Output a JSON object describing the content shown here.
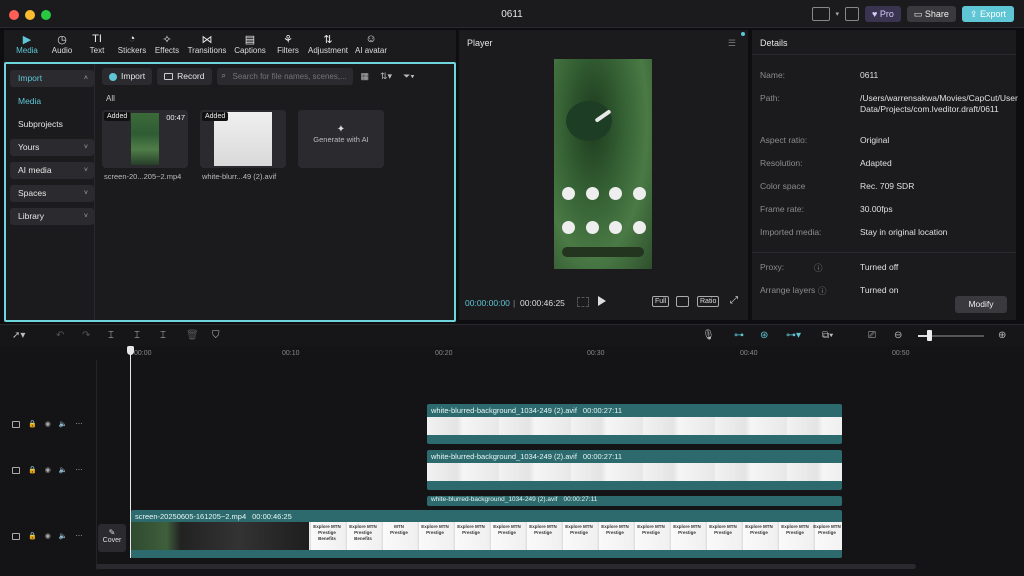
{
  "window": {
    "title": "0611"
  },
  "titlebar": {
    "pro_label": "Pro",
    "share_label": "Share",
    "export_label": "Export"
  },
  "tools": [
    {
      "label": "Media",
      "icon": "media-icon",
      "glyph": "▶"
    },
    {
      "label": "Audio",
      "icon": "audio-icon",
      "glyph": "◷"
    },
    {
      "label": "Text",
      "icon": "text-icon",
      "glyph": "TI"
    },
    {
      "label": "Stickers",
      "icon": "stickers-icon",
      "glyph": "◔"
    },
    {
      "label": "Effects",
      "icon": "effects-icon",
      "glyph": "✧"
    },
    {
      "label": "Transitions",
      "icon": "transitions-icon",
      "glyph": "⋈"
    },
    {
      "label": "Captions",
      "icon": "captions-icon",
      "glyph": "▤"
    },
    {
      "label": "Filters",
      "icon": "filters-icon",
      "glyph": "⚘"
    },
    {
      "label": "Adjustment",
      "icon": "adjustment-icon",
      "glyph": "⇅"
    },
    {
      "label": "AI avatar",
      "icon": "ai-avatar-icon",
      "glyph": "☺"
    }
  ],
  "sidebar": {
    "import": "Import",
    "media": "Media",
    "subprojects": "Subprojects",
    "yours": "Yours",
    "ai_media": "AI media",
    "spaces": "Spaces",
    "library": "Library"
  },
  "media": {
    "import_button": "Import",
    "record_button": "Record",
    "search_placeholder": "Search for file names, scenes,...",
    "all_label": "All",
    "items": [
      {
        "name": "screen-20...205~2.mp4",
        "badge": "Added",
        "duration": "00:47"
      },
      {
        "name": "white-blurr...49 (2).avif",
        "badge": "Added",
        "duration": ""
      }
    ],
    "generate_label": "Generate with AI"
  },
  "player": {
    "title": "Player",
    "current_time": "00:00:00:00",
    "total_time": "00:00:46:25",
    "full_label": "Full",
    "ratio_label": "Ratio"
  },
  "details": {
    "title": "Details",
    "rows": [
      {
        "key": "Name:",
        "value": "0611"
      },
      {
        "key": "Path:",
        "value": "/Users/warrensakwa/Movies/CapCut/User Data/Projects/com.lveditor.draft/0611"
      },
      {
        "key": "Aspect ratio:",
        "value": "Original"
      },
      {
        "key": "Resolution:",
        "value": "Adapted"
      },
      {
        "key": "Color space",
        "value": "Rec. 709 SDR"
      },
      {
        "key": "Frame rate:",
        "value": "30.00fps"
      },
      {
        "key": "Imported media:",
        "value": "Stay in original location"
      },
      {
        "key": "Proxy:",
        "value": "Turned off"
      },
      {
        "key": "Arrange layers",
        "value": "Turned on"
      }
    ],
    "modify_label": "Modify"
  },
  "timeline": {
    "ruler": [
      "00:00",
      "00:10",
      "00:20",
      "00:30",
      "00:40",
      "00:50"
    ],
    "clips": [
      {
        "name": "white-blurred-background_1034-249 (2).avif",
        "duration": "00:00:27:11"
      },
      {
        "name": "white-blurred-background_1034-249 (2).avif",
        "duration": "00:00:27:11"
      },
      {
        "name": "white-blurred-background_1034-249 (2).avif",
        "duration": "00:00:27:11"
      }
    ],
    "main_clip": {
      "name": "screen-20250605-161205~2.mp4",
      "duration": "00:00:46:25"
    },
    "cover_label": "Cover",
    "frame_labels": [
      "Explore MTN Prestige",
      "Explore MTN Prestige Benefits",
      "MTN Prestige"
    ]
  }
}
